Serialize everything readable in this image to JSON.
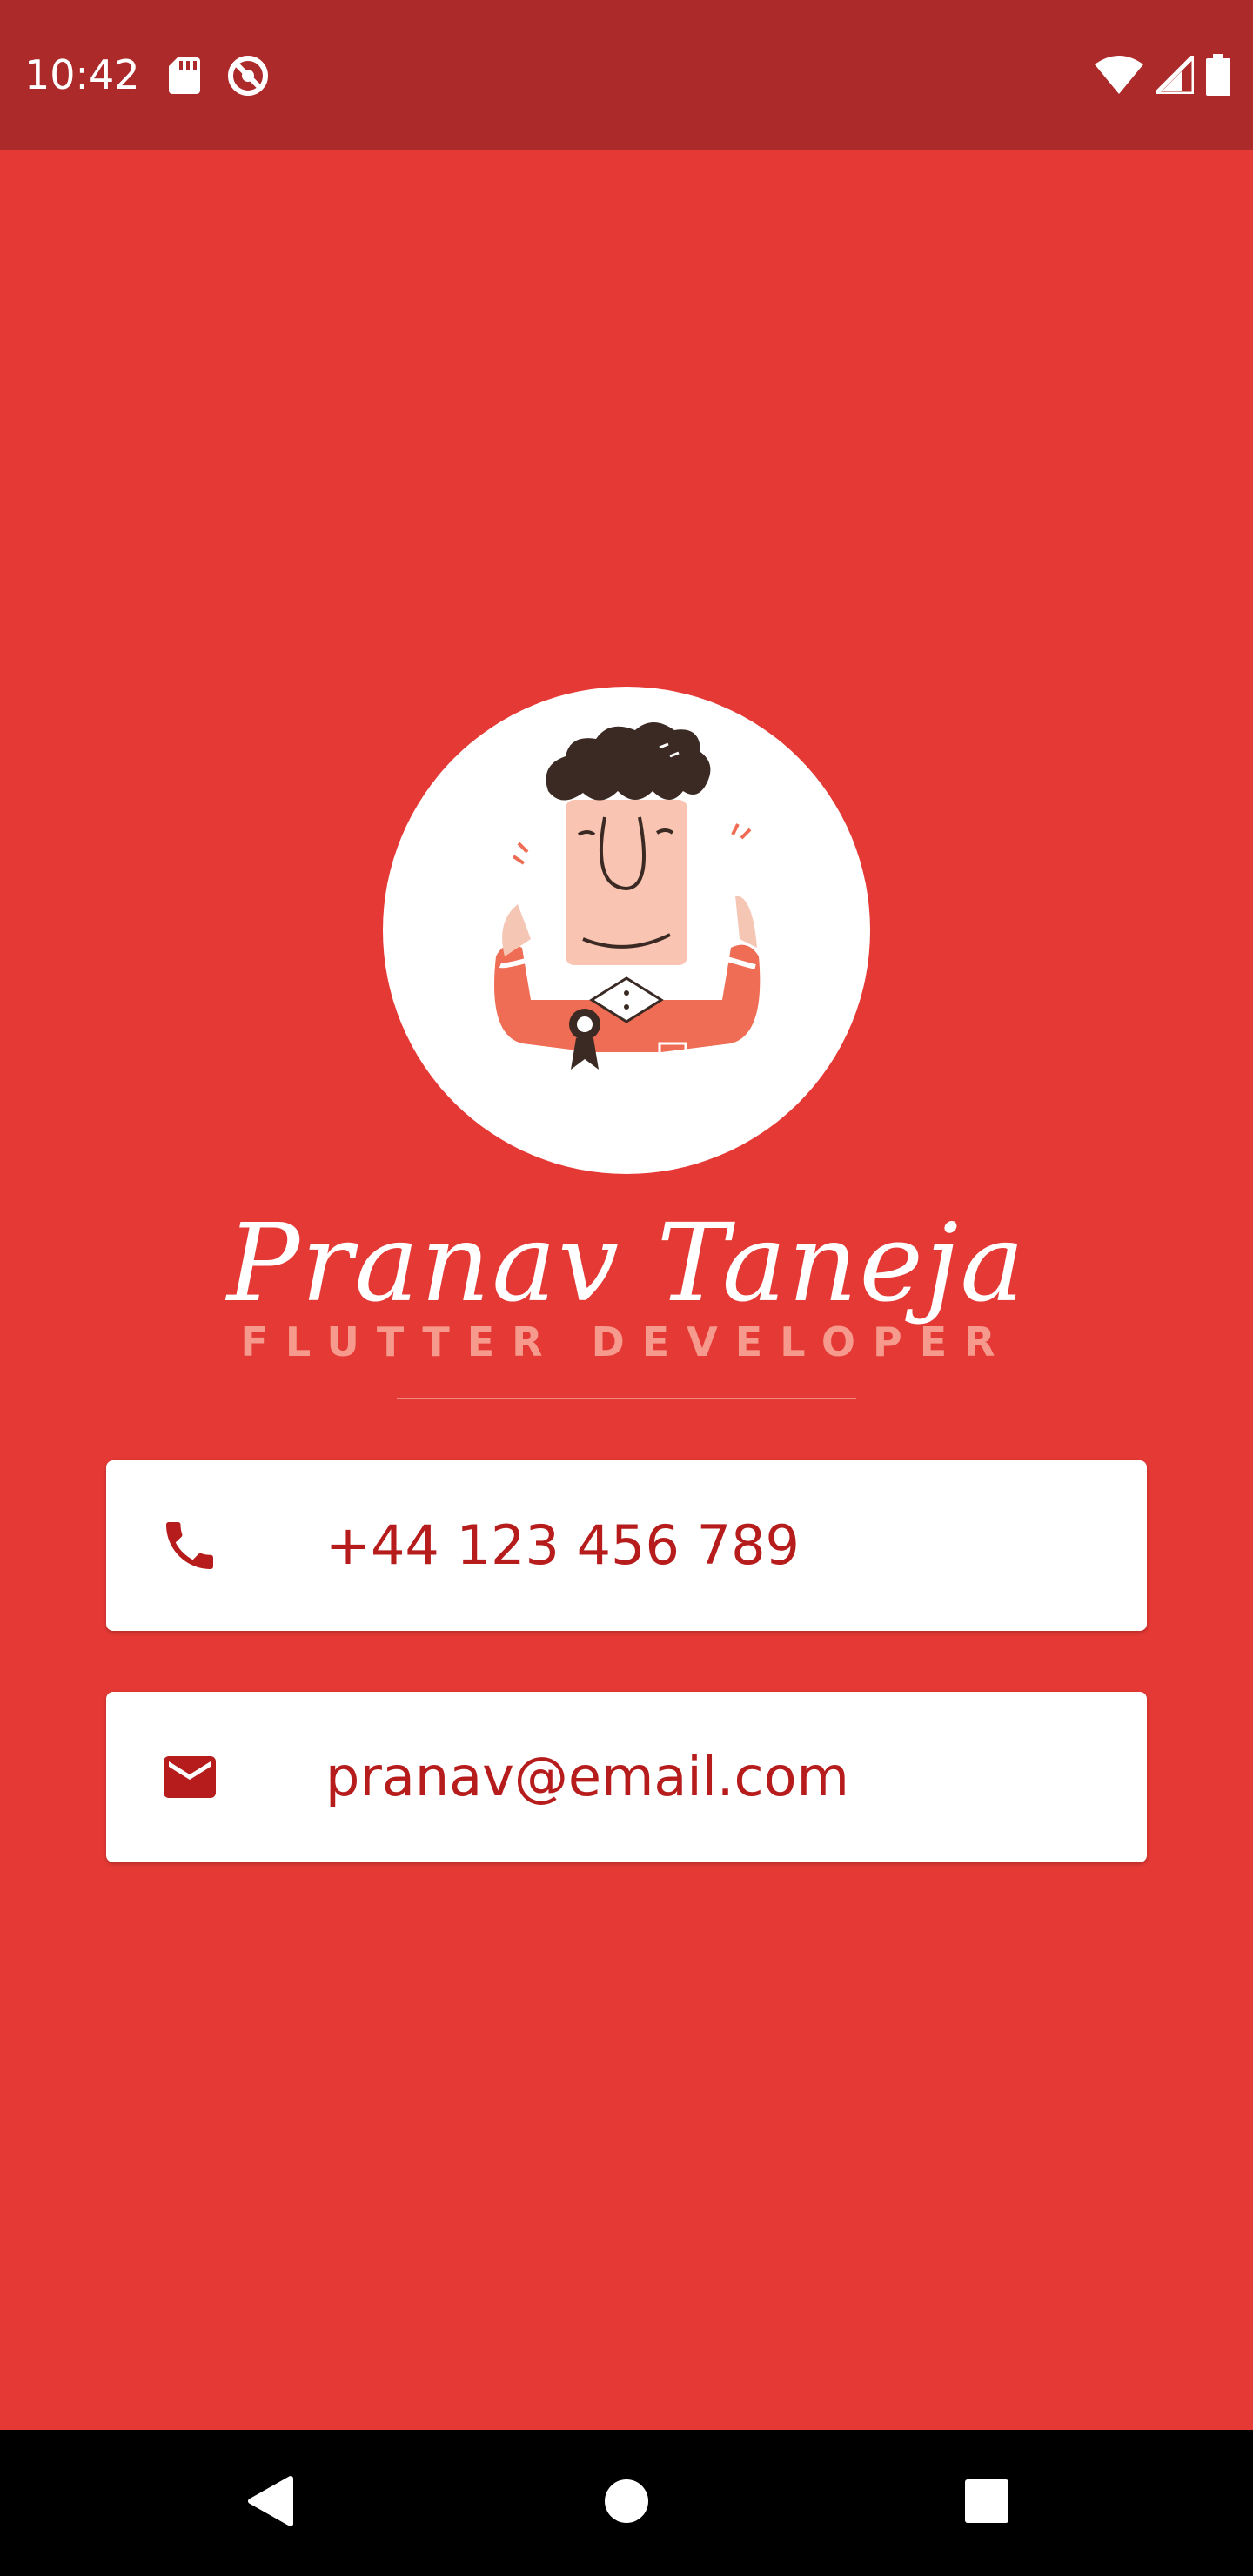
{
  "status_bar": {
    "time": "10:42",
    "left_icons": [
      "sd-card-icon",
      "do-not-disturb-icon"
    ],
    "right_icons": [
      "wifi-icon",
      "cellular-signal-icon",
      "battery-icon"
    ]
  },
  "profile": {
    "avatar_icon": "cartoon-man-avatar",
    "name": "Pranav Taneja",
    "role": "FLUTTER DEVELOPER"
  },
  "contacts": {
    "phone": {
      "icon": "phone-icon",
      "value": "+44 123 456 789"
    },
    "email": {
      "icon": "email-icon",
      "value": "pranav@email.com"
    }
  },
  "nav_bar": {
    "buttons": [
      "back-icon",
      "home-icon",
      "recents-icon"
    ]
  },
  "colors": {
    "background": "#E53935",
    "status_bar": "#AD2A2A",
    "card": "#FFFFFF",
    "card_text": "#B71C1C",
    "role_text": "#F59A8C"
  }
}
